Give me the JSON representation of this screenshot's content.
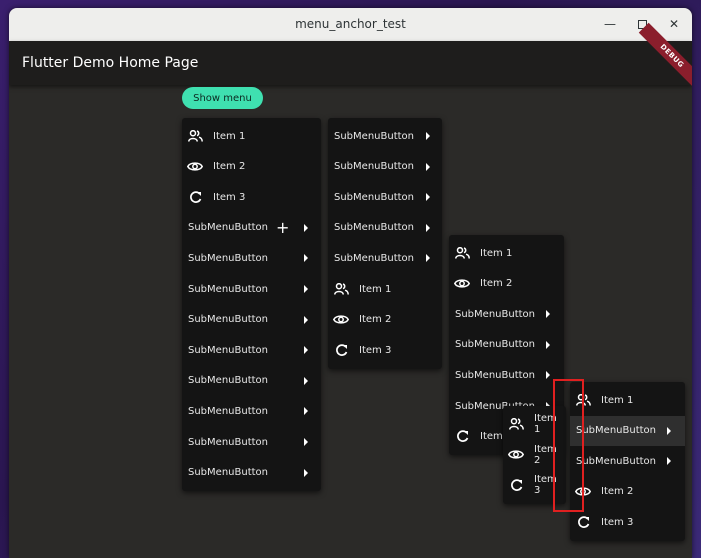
{
  "window": {
    "title": "menu_anchor_test",
    "controls": [
      "minimize",
      "maximize",
      "close"
    ]
  },
  "appbar": {
    "title": "Flutter Demo Home Page",
    "badge": "DEBUG"
  },
  "show_menu_button": {
    "label": "Show menu"
  },
  "colors": {
    "accent": "#3fe0b0",
    "menu_bg": "#141414",
    "window_bg": "#2b2a28",
    "debug_banner": "#8b1e2c",
    "highlight": "#e02020"
  },
  "menus": [
    {
      "id": "menu1",
      "items": [
        {
          "type": "item",
          "icon": "people-icon",
          "label": "Item 1"
        },
        {
          "type": "item",
          "icon": "eye-icon",
          "label": "Item 2"
        },
        {
          "type": "item",
          "icon": "refresh-icon",
          "label": "Item 3"
        },
        {
          "type": "submenu",
          "label": "SubMenuButton",
          "plus": true
        },
        {
          "type": "submenu",
          "label": "SubMenuButton"
        },
        {
          "type": "submenu",
          "label": "SubMenuButton"
        },
        {
          "type": "submenu",
          "label": "SubMenuButton"
        },
        {
          "type": "submenu",
          "label": "SubMenuButton"
        },
        {
          "type": "submenu",
          "label": "SubMenuButton"
        },
        {
          "type": "submenu",
          "label": "SubMenuButton"
        },
        {
          "type": "submenu",
          "label": "SubMenuButton"
        },
        {
          "type": "submenu",
          "label": "SubMenuButton"
        }
      ]
    },
    {
      "id": "menu2",
      "items": [
        {
          "type": "submenu",
          "label": "SubMenuButton"
        },
        {
          "type": "submenu",
          "label": "SubMenuButton"
        },
        {
          "type": "submenu",
          "label": "SubMenuButton"
        },
        {
          "type": "submenu",
          "label": "SubMenuButton"
        },
        {
          "type": "submenu",
          "label": "SubMenuButton"
        },
        {
          "type": "item",
          "icon": "people-icon",
          "label": "Item 1"
        },
        {
          "type": "item",
          "icon": "eye-icon",
          "label": "Item 2"
        },
        {
          "type": "item",
          "icon": "refresh-icon",
          "label": "Item 3"
        }
      ]
    },
    {
      "id": "menu3",
      "items": [
        {
          "type": "item",
          "icon": "people-icon",
          "label": "Item 1"
        },
        {
          "type": "item",
          "icon": "eye-icon",
          "label": "Item 2"
        },
        {
          "type": "submenu",
          "label": "SubMenuButton"
        },
        {
          "type": "submenu",
          "label": "SubMenuButton"
        },
        {
          "type": "submenu",
          "label": "SubMenuButton"
        },
        {
          "type": "submenu",
          "label": "SubMenuButton"
        },
        {
          "type": "item",
          "icon": "refresh-icon",
          "label": "Item 3"
        }
      ]
    },
    {
      "id": "menu4",
      "items": [
        {
          "type": "item",
          "icon": "people-icon",
          "label": "Item 1"
        },
        {
          "type": "item",
          "icon": "eye-icon",
          "label": "Item 2"
        },
        {
          "type": "item",
          "icon": "refresh-icon",
          "label": "Item 3"
        }
      ]
    },
    {
      "id": "menu5",
      "items": [
        {
          "type": "item",
          "icon": "people-icon",
          "label": "Item 1"
        },
        {
          "type": "submenu",
          "label": "SubMenuButton",
          "highlighted": true
        },
        {
          "type": "submenu",
          "label": "SubMenuButton"
        },
        {
          "type": "item",
          "icon": "eye-icon",
          "label": "Item 2"
        },
        {
          "type": "item",
          "icon": "refresh-icon",
          "label": "Item 3"
        }
      ]
    }
  ]
}
